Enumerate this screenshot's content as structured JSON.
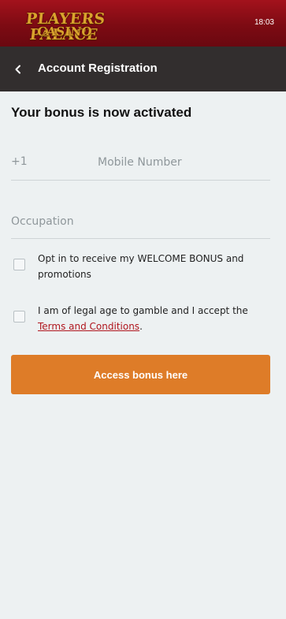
{
  "header": {
    "logo_line1": "PLAYERS PALACE",
    "logo_line2": "CASINO",
    "time": "18:03",
    "brand_color": "#8e0e17",
    "logo_color": "#d9a22d"
  },
  "nav": {
    "back_icon": "chevron-left-icon",
    "title": "Account Registration",
    "bg_color": "#322e2e"
  },
  "form": {
    "heading": "Your bonus is now activated",
    "phone_prefix": "+1",
    "phone_placeholder": "Mobile Number",
    "phone_value": "",
    "occupation_placeholder": "Occupation",
    "occupation_value": "",
    "optin_label": "Opt in to receive my WELCOME BONUS and promotions",
    "optin_checked": false,
    "age_label_before": "I am of legal age to gamble and I accept the ",
    "terms_link": "Terms and Conditions",
    "age_label_after": ".",
    "age_checked": false,
    "link_color": "#b0161e"
  },
  "cta": {
    "label": "Access bonus here",
    "color": "#de7c28"
  }
}
